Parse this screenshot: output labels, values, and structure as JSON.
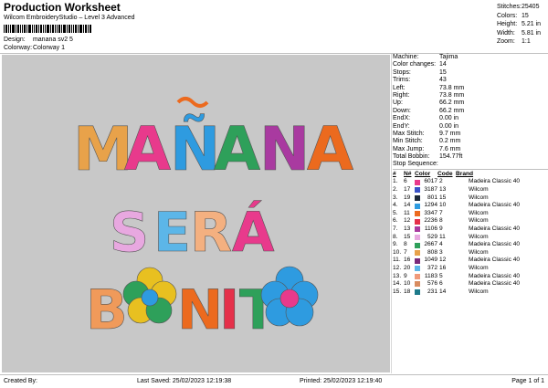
{
  "header": {
    "title": "Production Worksheet",
    "subtitle": "Wilcom EmbroideryStudio – Level 3 Advanced",
    "design_label": "Design:",
    "design_value": "manana sv2 5",
    "colorway_label": "Colorway:",
    "colorway_value": "Colorway 1"
  },
  "stats": [
    {
      "label": "Stitches:",
      "value": "25405"
    },
    {
      "label": "Colors:",
      "value": "15"
    },
    {
      "label": "Height:",
      "value": "5.21 in"
    },
    {
      "label": "Width:",
      "value": "5.81 in"
    },
    {
      "label": "Zoom:",
      "value": "1:1"
    }
  ],
  "details": [
    {
      "label": "Machine:",
      "value": "Tajima"
    },
    {
      "label": "Color changes:",
      "value": "14"
    },
    {
      "label": "Stops:",
      "value": "15"
    },
    {
      "label": "Trims:",
      "value": "43"
    },
    {
      "label": "Left:",
      "value": "73.8 mm"
    },
    {
      "label": "Right:",
      "value": "73.8 mm"
    },
    {
      "label": "Up:",
      "value": "66.2 mm"
    },
    {
      "label": "Down:",
      "value": "66.2 mm"
    },
    {
      "label": "EndX:",
      "value": "0.00 in"
    },
    {
      "label": "EndY:",
      "value": "0.00 in"
    },
    {
      "label": "Max Stitch:",
      "value": "9.7 mm"
    },
    {
      "label": "Min Stitch:",
      "value": "0.2 mm"
    },
    {
      "label": "Max Jump:",
      "value": "7.6 mm"
    },
    {
      "label": "Total Bobbin:",
      "value": "154.77ft"
    }
  ],
  "stop_sequence": {
    "title": "Stop Sequence:",
    "headers": {
      "n": "#",
      "n2": "N#",
      "color": "Color",
      "code": "Code",
      "brand": "Brand"
    },
    "rows": [
      {
        "no": "1.",
        "n": "6",
        "color": "#e83a8c",
        "code": "6017",
        "stitches": "2",
        "brand": "Madeira Classic 40"
      },
      {
        "no": "2.",
        "n": "17",
        "color": "#3a52c8",
        "code": "3187",
        "stitches": "13",
        "brand": "Wilcom"
      },
      {
        "no": "3.",
        "n": "19",
        "color": "#1e2a3a",
        "code": "801",
        "stitches": "15",
        "brand": "Wilcom"
      },
      {
        "no": "4.",
        "n": "14",
        "color": "#2e9be0",
        "code": "1294",
        "stitches": "10",
        "brand": "Madeira Classic 40"
      },
      {
        "no": "5.",
        "n": "11",
        "color": "#ec6a1e",
        "code": "3347",
        "stitches": "7",
        "brand": "Wilcom"
      },
      {
        "no": "6.",
        "n": "12",
        "color": "#e5304a",
        "code": "2236",
        "stitches": "8",
        "brand": "Wilcom"
      },
      {
        "no": "7.",
        "n": "13",
        "color": "#a93aa0",
        "code": "1106",
        "stitches": "9",
        "brand": "Madeira Classic 40"
      },
      {
        "no": "8.",
        "n": "15",
        "color": "#e8a8e0",
        "code": "529",
        "stitches": "11",
        "brand": "Wilcom"
      },
      {
        "no": "9.",
        "n": "8",
        "color": "#2ea05a",
        "code": "2667",
        "stitches": "4",
        "brand": "Madeira Classic 40"
      },
      {
        "no": "10.",
        "n": "7",
        "color": "#e8a24a",
        "code": "808",
        "stitches": "3",
        "brand": "Wilcom"
      },
      {
        "no": "11.",
        "n": "16",
        "color": "#7a2a7a",
        "code": "1049",
        "stitches": "12",
        "brand": "Madeira Classic 40"
      },
      {
        "no": "12.",
        "n": "20",
        "color": "#5cb6e8",
        "code": "372",
        "stitches": "16",
        "brand": "Wilcom"
      },
      {
        "no": "13.",
        "n": "9",
        "color": "#f09a7a",
        "code": "1183",
        "stitches": "5",
        "brand": "Madeira Classic 40"
      },
      {
        "no": "14.",
        "n": "10",
        "color": "#d88c60",
        "code": "576",
        "stitches": "6",
        "brand": "Madeira Classic 40"
      },
      {
        "no": "15.",
        "n": "18",
        "color": "#1e7a8a",
        "code": "231",
        "stitches": "14",
        "brand": "Wilcom"
      }
    ]
  },
  "design_preview": {
    "lines": [
      "MAÑANA",
      "SERÁ",
      "BONITO"
    ]
  },
  "footer": {
    "created_by": "Created By:",
    "last_saved": "Last Saved: 25/02/2023 12:19:38",
    "printed": "Printed: 25/02/2023 12:19:40",
    "page": "Page 1 of 1"
  }
}
